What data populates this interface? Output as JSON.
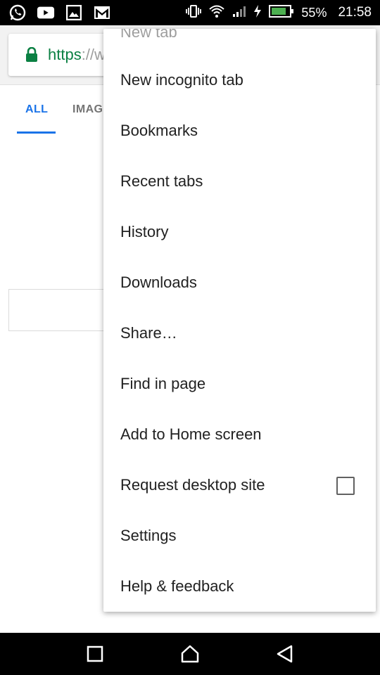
{
  "status_bar": {
    "battery": "55%",
    "time": "21:58",
    "left_icons": [
      "whatsapp-icon",
      "youtube-icon",
      "gallery-icon",
      "gmail-icon"
    ],
    "right_icons": [
      "vibrate-icon",
      "wifi-icon",
      "signal-icon",
      "charging-icon",
      "battery-icon"
    ]
  },
  "browser": {
    "url": {
      "scheme": "https",
      "separator": "://",
      "rest": "w"
    },
    "tabs": [
      "ALL",
      "IMAG"
    ],
    "active_tab": "ALL",
    "accent_color": "#1a73e8",
    "url_color": "#0b8043"
  },
  "menu": {
    "items": [
      {
        "label": "New tab"
      },
      {
        "label": "New incognito tab"
      },
      {
        "label": "Bookmarks"
      },
      {
        "label": "Recent tabs"
      },
      {
        "label": "History"
      },
      {
        "label": "Downloads"
      },
      {
        "label": "Share…"
      },
      {
        "label": "Find in page"
      },
      {
        "label": "Add to Home screen"
      },
      {
        "label": "Request desktop site",
        "checked": false
      },
      {
        "label": "Settings"
      },
      {
        "label": "Help & feedback"
      }
    ]
  },
  "nav_bar": {
    "buttons": [
      "recents-icon",
      "home-icon",
      "back-icon"
    ]
  }
}
